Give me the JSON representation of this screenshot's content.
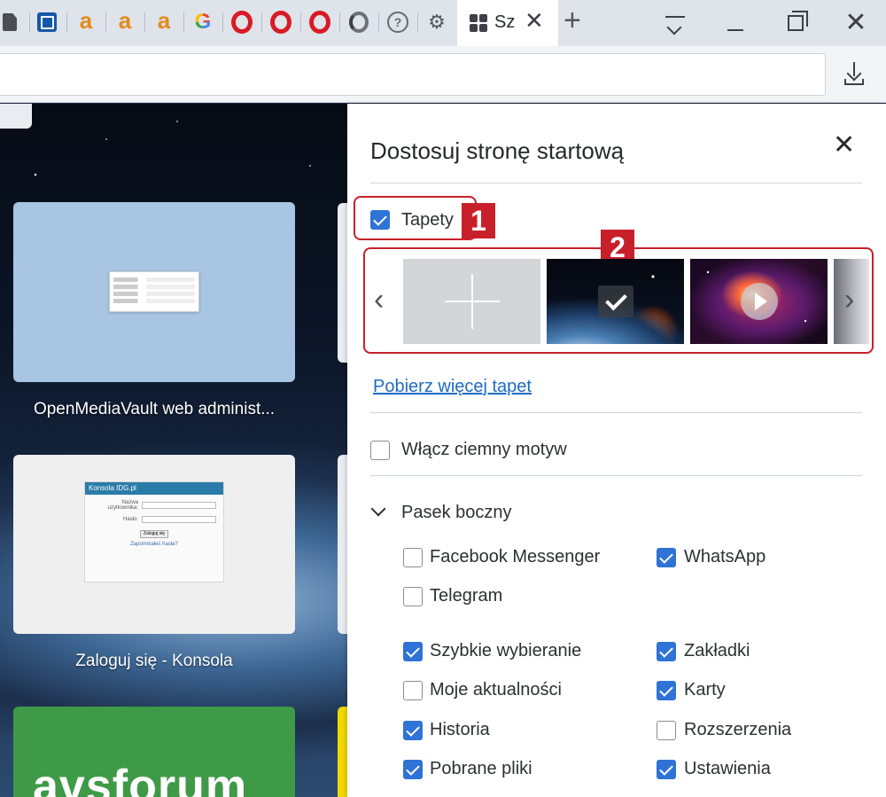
{
  "tabs": {
    "icons": [
      "doc-icon",
      "box-icon",
      "amazon-icon",
      "amazon-icon",
      "amazon-icon",
      "google-icon",
      "opera-icon",
      "opera-icon",
      "opera-icon",
      "opera-gx-icon",
      "help-icon",
      "gear-icon"
    ],
    "amazon_glyph": "a",
    "google_glyph": "G",
    "help_glyph": "?",
    "gear_glyph": "⚙",
    "active_tab_title": "Sz",
    "close_glyph": "✕",
    "new_tab_glyph": "+",
    "window_close_glyph": "✕"
  },
  "address_bar": {
    "value": "",
    "placeholder": ""
  },
  "speed_dial": {
    "tiles": [
      {
        "label": "OpenMediaVault web administ..."
      },
      {
        "label": "Zaloguj się - Konsola",
        "window_title": "Konsola IDG.pl",
        "field_user": "Nazwa użytkownika:",
        "field_pass": "Hasło:",
        "button": "Zaloguj się",
        "link": "Zapomniałeś hasła?"
      },
      {
        "label": "",
        "tile_text": "avsforum"
      }
    ]
  },
  "panel": {
    "title": "Dostosuj stronę startową",
    "close_glyph": "✕",
    "wallpapers": {
      "label": "Tapety",
      "checked": true,
      "prev_glyph": "‹",
      "next_glyph": "›",
      "items": [
        "add-wallpaper",
        "earth-wallpaper-selected",
        "nebula-wallpaper-animated",
        "partial-wallpaper"
      ],
      "more_link": "Pobierz więcej tapet"
    },
    "dark_theme": {
      "label": "Włącz ciemny motyw",
      "checked": false
    },
    "sidebar": {
      "label": "Pasek boczny",
      "messengers": [
        {
          "label": "Facebook Messenger",
          "checked": false
        },
        {
          "label": "WhatsApp",
          "checked": true
        },
        {
          "label": "Telegram",
          "checked": false
        }
      ],
      "features": [
        {
          "label": "Szybkie wybieranie",
          "checked": true
        },
        {
          "label": "Zakładki",
          "checked": true
        },
        {
          "label": "Moje aktualności",
          "checked": false
        },
        {
          "label": "Karty",
          "checked": true
        },
        {
          "label": "Historia",
          "checked": true
        },
        {
          "label": "Rozszerzenia",
          "checked": false
        },
        {
          "label": "Pobrane pliki",
          "checked": true
        },
        {
          "label": "Ustawienia",
          "checked": true
        }
      ]
    },
    "callouts": [
      "1",
      "2"
    ]
  },
  "colors": {
    "accent": "#2f73d6",
    "callout": "#c8202a",
    "link": "#1f6bc4"
  }
}
